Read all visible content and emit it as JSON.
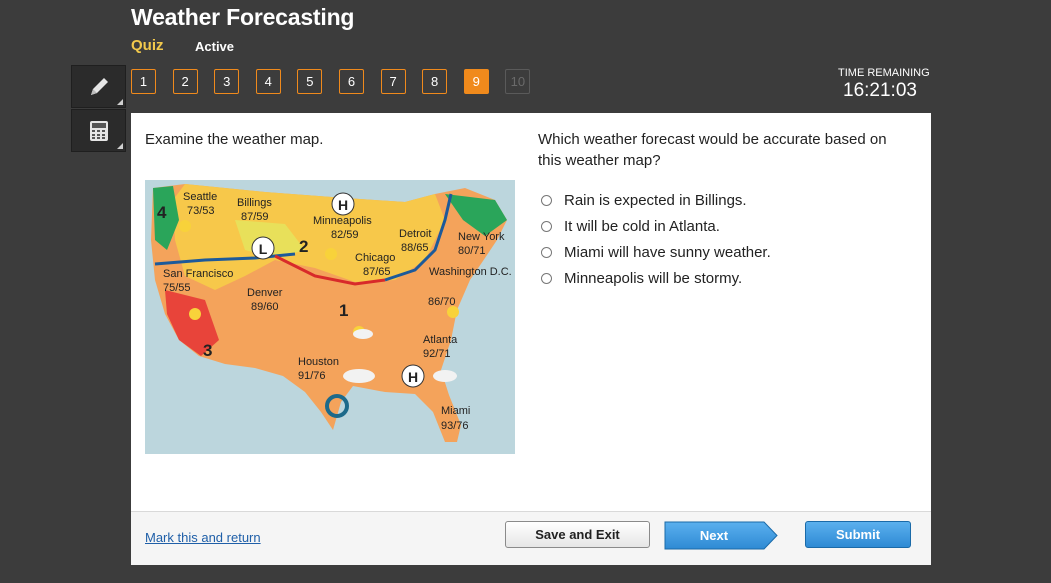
{
  "header": {
    "title": "Weather Forecasting",
    "subtitle": "Quiz",
    "status": "Active"
  },
  "tools": [
    {
      "name": "pencil-icon",
      "label": "pencil"
    },
    {
      "name": "calculator-icon",
      "label": "calculator"
    }
  ],
  "nav": {
    "questions": [
      "1",
      "2",
      "3",
      "4",
      "5",
      "6",
      "7",
      "8",
      "9",
      "10"
    ],
    "current": "9",
    "disabled": [
      "10"
    ]
  },
  "timer": {
    "label": "TIME REMAINING",
    "value": "16:21:03"
  },
  "question": {
    "left_prompt": "Examine the weather map.",
    "right_prompt": "Which weather forecast would be accurate based on this weather map?",
    "choices": [
      "Rain is expected in Billings.",
      "It will be cold in Atlanta.",
      "Miami will have sunny weather.",
      "Minneapolis will be stormy."
    ]
  },
  "map": {
    "cities": [
      {
        "name": "Seattle",
        "temp": "73/53"
      },
      {
        "name": "Billings",
        "temp": "87/59"
      },
      {
        "name": "Minneapolis",
        "temp": "82/59"
      },
      {
        "name": "Detroit",
        "temp": "88/65"
      },
      {
        "name": "New York",
        "temp": "80/71"
      },
      {
        "name": "Chicago",
        "temp": "87/65"
      },
      {
        "name": "Washington D.C.",
        "temp": "86/70"
      },
      {
        "name": "San Francisco",
        "temp": "75/55"
      },
      {
        "name": "Denver",
        "temp": "89/60"
      },
      {
        "name": "Atlanta",
        "temp": "92/71"
      },
      {
        "name": "Houston",
        "temp": "91/76"
      },
      {
        "name": "Miami",
        "temp": "93/76"
      }
    ],
    "zones": [
      "1",
      "2",
      "3",
      "4"
    ],
    "pressure": [
      "H",
      "L",
      "H",
      "H"
    ],
    "colors": {
      "water": "#bcd6dd",
      "hot": "#f4a35b",
      "warm": "#f7c84a",
      "mild": "#e8e05a",
      "red": "#e8443a",
      "green": "#2aa55a"
    }
  },
  "footer": {
    "mark_link": "Mark this and return",
    "save": "Save and Exit",
    "next": "Next",
    "submit": "Submit"
  }
}
